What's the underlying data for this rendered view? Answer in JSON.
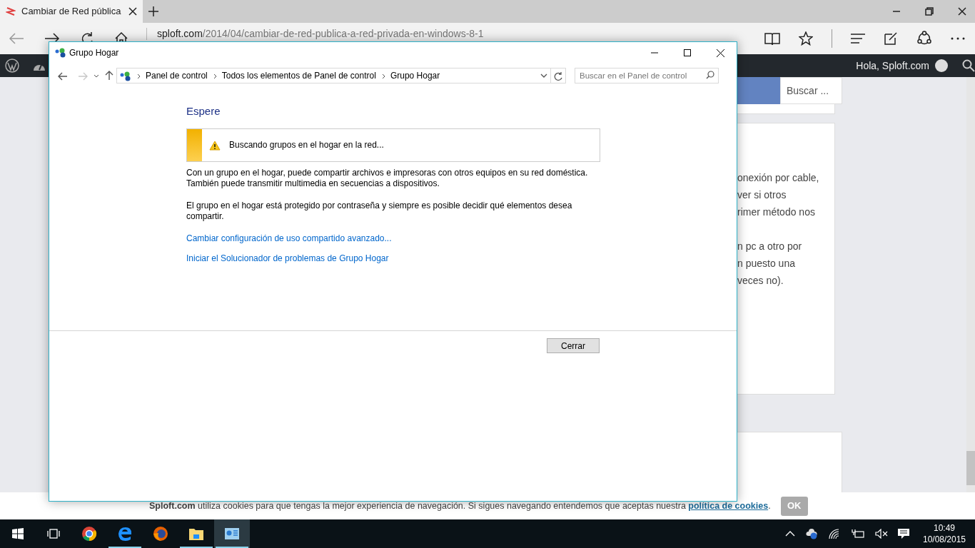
{
  "browser": {
    "tab_title": "Cambiar de Red pública",
    "back_disabled": true,
    "url_domain": "sploft.com",
    "url_path": "/2014/04/cambiar-de-red-publica-a-red-privada-en-windows-8-1"
  },
  "admin_bar": {
    "greeting": "Hola, Sploft.com"
  },
  "sidebar_search": {
    "placeholder": "Buscar ..."
  },
  "article": {
    "paragraphs": [
      [
        "onexión por cable,",
        "ver si otros",
        "rimer método nos"
      ],
      [
        "n pc a otro por",
        "n puesto una",
        "veces no)."
      ]
    ]
  },
  "dialog": {
    "title": "Grupo Hogar",
    "nav": [
      {
        "kind": "back",
        "disabled": false
      },
      {
        "kind": "forward",
        "disabled": true
      }
    ],
    "breadcrumb": [
      "Panel de control",
      "Todos los elementos de Panel de control",
      "Grupo Hogar"
    ],
    "search": {
      "placeholder": "Buscar en el Panel de control"
    },
    "heading": "Espere",
    "status": "Buscando grupos en el hogar en la red...",
    "paragraphs": [
      "Con un grupo en el hogar, puede compartir archivos e impresoras con otros equipos en su red doméstica. También puede transmitir multimedia en secuencias a dispositivos.",
      "El grupo en el hogar está protegido por contraseña y siempre es posible decidir qué elementos desea compartir."
    ],
    "links": [
      "Cambiar configuración de uso compartido avanzado...",
      "Iniciar el Solucionador de problemas de Grupo Hogar"
    ],
    "button": "Cerrar"
  },
  "cookie_bar": {
    "text": "**Sploft.com** utiliza cookies para que tengas la mejor experiencia de navegación. Si sigues navegando entendemos que aceptas nuestra",
    "link": "política de cookies",
    "after": ".",
    "button": "OK"
  },
  "taskbar": {
    "apps": [
      {
        "kind": "chrome",
        "running": false,
        "selected": false
      },
      {
        "kind": "edge",
        "running": true,
        "selected": false
      },
      {
        "kind": "firefox",
        "running": false,
        "selected": false
      },
      {
        "kind": "explorer",
        "running": true,
        "selected": false
      },
      {
        "kind": "control-panel",
        "running": true,
        "selected": true
      }
    ],
    "time": "10:49",
    "date": "10/08/2015"
  }
}
